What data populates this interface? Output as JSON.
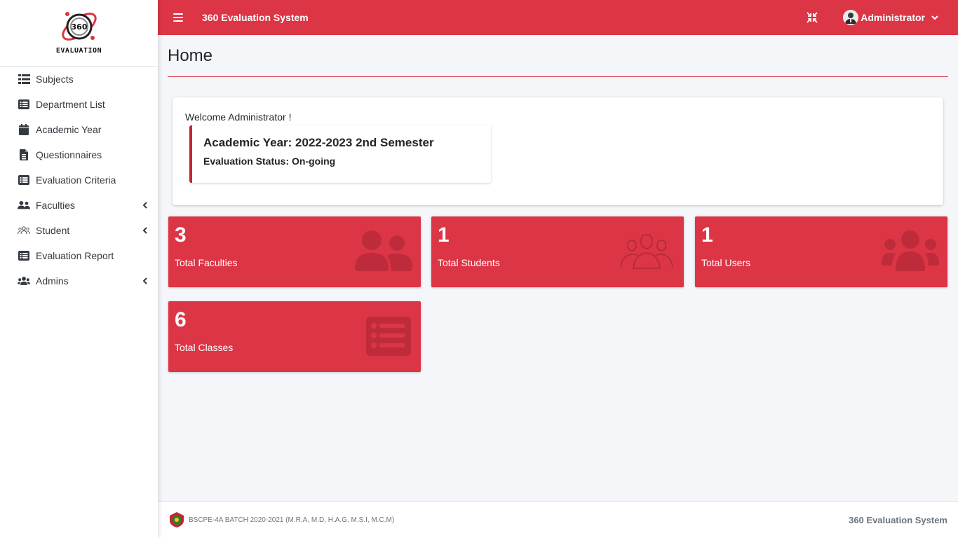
{
  "brand": {
    "logo_text": "360",
    "name": "EVALUATION"
  },
  "topbar": {
    "app_title": "360 Evaluation System",
    "user_name": "Administrator"
  },
  "sidebar": {
    "items": [
      {
        "label": "Subjects",
        "icon": "list-icon",
        "has_submenu": false
      },
      {
        "label": "Department List",
        "icon": "list-alt-icon",
        "has_submenu": false
      },
      {
        "label": "Academic Year",
        "icon": "calendar-icon",
        "has_submenu": false
      },
      {
        "label": "Questionnaires",
        "icon": "file-alt-icon",
        "has_submenu": false
      },
      {
        "label": "Evaluation Criteria",
        "icon": "list-alt-icon",
        "has_submenu": false
      },
      {
        "label": "Faculties",
        "icon": "user-friends-icon",
        "has_submenu": true
      },
      {
        "label": "Student",
        "icon": "user-group-outline-icon",
        "has_submenu": true
      },
      {
        "label": "Evaluation Report",
        "icon": "list-alt-icon",
        "has_submenu": false
      },
      {
        "label": "Admins",
        "icon": "users-icon",
        "has_submenu": true
      }
    ]
  },
  "main": {
    "page_title": "Home",
    "welcome": "Welcome Administrator !",
    "academic_year": "Academic Year: 2022-2023 2nd Semester",
    "evaluation_status": "Evaluation Status: On-going",
    "stats": [
      {
        "value": "3",
        "label": "Total Faculties",
        "icon": "user-friends-icon"
      },
      {
        "value": "1",
        "label": "Total Students",
        "icon": "user-group-outline-icon"
      },
      {
        "value": "1",
        "label": "Total Users",
        "icon": "users-icon"
      },
      {
        "value": "6",
        "label": "Total Classes",
        "icon": "list-alt-icon"
      }
    ]
  },
  "footer": {
    "left": "BSCPE-4A BATCH 2020-2021 (M.R.A, M.D, H.A.G, M.S.I, M.C.M)",
    "right": "360 Evaluation System"
  },
  "colors": {
    "accent": "#dc3545",
    "icon_dark": "#343a40",
    "background": "#f4f6f9"
  }
}
